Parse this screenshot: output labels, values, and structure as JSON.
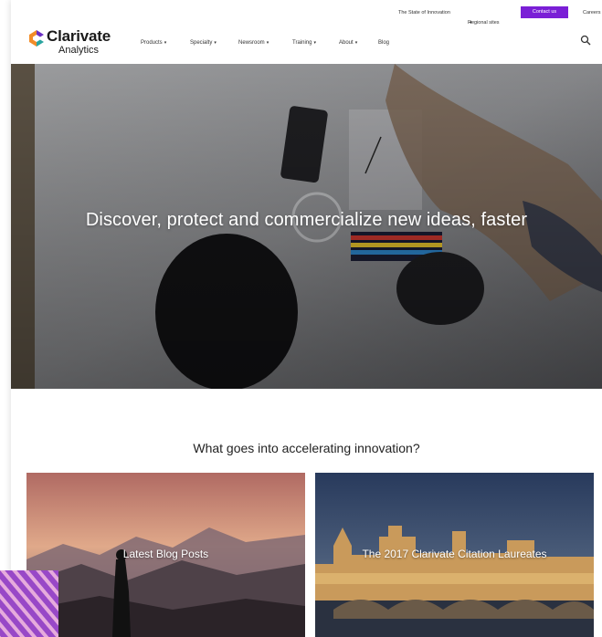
{
  "utility_bar": {
    "state_of_innovation": "The State of Innovation",
    "regional_sites": "Regional sites",
    "contact_us": "Contact us",
    "careers": "Careers"
  },
  "logo": {
    "name": "Clarivate",
    "sub": "Analytics"
  },
  "nav": {
    "products": "Products",
    "specialty": "Specialty",
    "newsroom": "Newsroom",
    "training": "Training",
    "about": "About",
    "blog": "Blog",
    "caret": "▾"
  },
  "hero": {
    "title": "Discover, protect and commercialize new ideas, faster"
  },
  "section": {
    "title": "What goes into accelerating innovation?"
  },
  "cards": {
    "blog": "Latest Blog Posts",
    "laureates": "The 2017 Clarivate Citation Laureates"
  },
  "colors": {
    "accent": "#7a1fd6",
    "logo_orange": "#f28c28",
    "logo_purple": "#6b2fc4"
  }
}
